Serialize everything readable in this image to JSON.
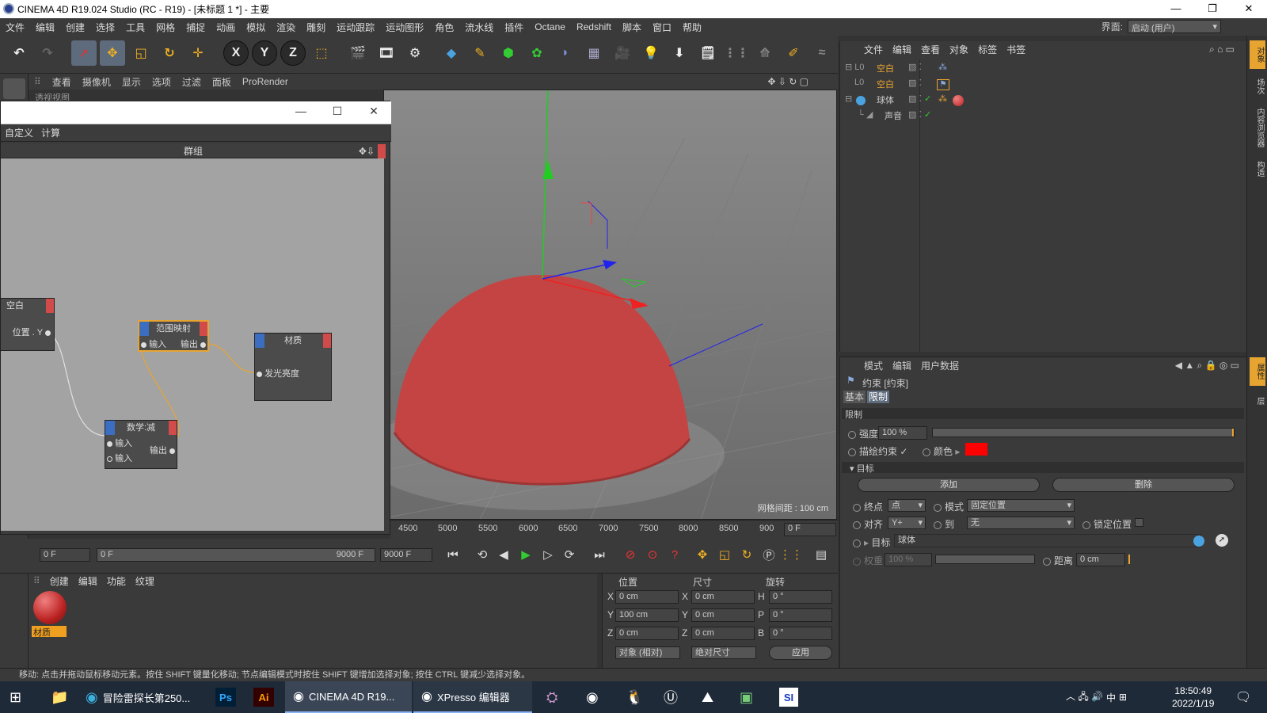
{
  "app": {
    "window_title": "CINEMA 4D R19.024 Studio (RC - R19) - [未标题 1 *] - 主要",
    "layout_label": "界面:",
    "layout_value": "启动 (用户)"
  },
  "menubar": [
    "文件",
    "编辑",
    "创建",
    "选择",
    "工具",
    "网格",
    "捕捉",
    "动画",
    "模拟",
    "渲染",
    "雕刻",
    "运动跟踪",
    "运动图形",
    "角色",
    "流水线",
    "插件",
    "Octane",
    "Redshift",
    "脚本",
    "窗口",
    "帮助"
  ],
  "viewport_menu": [
    "查看",
    "摄像机",
    "显示",
    "选项",
    "过滤",
    "面板",
    "ProRender"
  ],
  "viewport": {
    "tab": "透视视图",
    "grid_spacing": "网格间距 : 100 cm"
  },
  "xpresso": {
    "menu": [
      "自定义",
      "计算"
    ],
    "header": "群组",
    "nodes": {
      "null": {
        "title": "空白",
        "port": "位置 . Y"
      },
      "range": {
        "title": "范围映射",
        "in": "输入",
        "out": "输出"
      },
      "material": {
        "title": "材质",
        "port": "发光亮度"
      },
      "math": {
        "title": "数学:减",
        "in1": "输入",
        "in2": "输入",
        "out": "输出"
      }
    }
  },
  "timeline": {
    "ticks": [
      "4500",
      "5000",
      "5500",
      "6000",
      "6500",
      "7000",
      "7500",
      "8000",
      "8500",
      "900"
    ],
    "frame": "0 F"
  },
  "transport": {
    "start": "0 F",
    "range_start": "0 F",
    "range_end": "9000 F",
    "end": "9000 F"
  },
  "material_panel": {
    "menu": [
      "创建",
      "编辑",
      "功能",
      "纹理"
    ],
    "material_name": "材质"
  },
  "coords": {
    "headers": [
      "位置",
      "尺寸",
      "旋转"
    ],
    "rows": [
      {
        "a": "X",
        "pos": "0 cm",
        "b": "X",
        "size": "0 cm",
        "c": "H",
        "rot": "0 °"
      },
      {
        "a": "Y",
        "pos": "100 cm",
        "b": "Y",
        "size": "0 cm",
        "c": "P",
        "rot": "0 °"
      },
      {
        "a": "Z",
        "pos": "0 cm",
        "b": "Z",
        "size": "0 cm",
        "c": "B",
        "rot": "0 °"
      }
    ],
    "mode": "对象 (相对)",
    "size_mode": "绝对尺寸",
    "apply": "应用"
  },
  "status": "移动: 点击并拖动鼠标移动元素。按住 SHIFT 键量化移动; 节点编辑模式时按住 SHIFT 键增加选择对象; 按住 CTRL 键减少选择对象。",
  "objects": {
    "menu": [
      "文件",
      "编辑",
      "查看",
      "对象",
      "标签",
      "书签"
    ],
    "items": [
      {
        "name": "空白",
        "indent": 0
      },
      {
        "name": "空白",
        "indent": 1
      },
      {
        "name": "球体",
        "indent": 0
      },
      {
        "name": "声音",
        "indent": 1
      }
    ]
  },
  "attributes": {
    "menu": [
      "模式",
      "编辑",
      "用户数据"
    ],
    "title": "约束 [约束]",
    "tabs": [
      "基本",
      "限制"
    ],
    "section": "限制",
    "strength_label": "强度",
    "strength": "100 %",
    "draw_label": "描绘约束",
    "color_label": "颜色",
    "color": "#ff0000",
    "target_section": "目标",
    "add": "添加",
    "delete": "删除",
    "end_label": "终点",
    "end_value": "点",
    "mode_label": "模式",
    "mode_value": "固定位置",
    "align_label": "对齐",
    "align_value": "Y+",
    "to_label": "到",
    "to_value": "无",
    "lock_label": "锁定位置",
    "target_label": "目标",
    "target_value": "球体",
    "weight_label": "权重",
    "weight_value": "100 %",
    "distance_label": "距离",
    "distance_value": "0 cm"
  },
  "right_tabs": [
    "对象",
    "场次",
    "内容浏览器",
    "构造"
  ],
  "attr_tabs": [
    "属性",
    "层"
  ],
  "taskbar": {
    "items": [
      "冒险雷探长第250...",
      "CINEMA 4D R19...",
      "XPresso 编辑器"
    ],
    "time": "18:50:49",
    "date": "2022/1/19",
    "ime": "中"
  }
}
